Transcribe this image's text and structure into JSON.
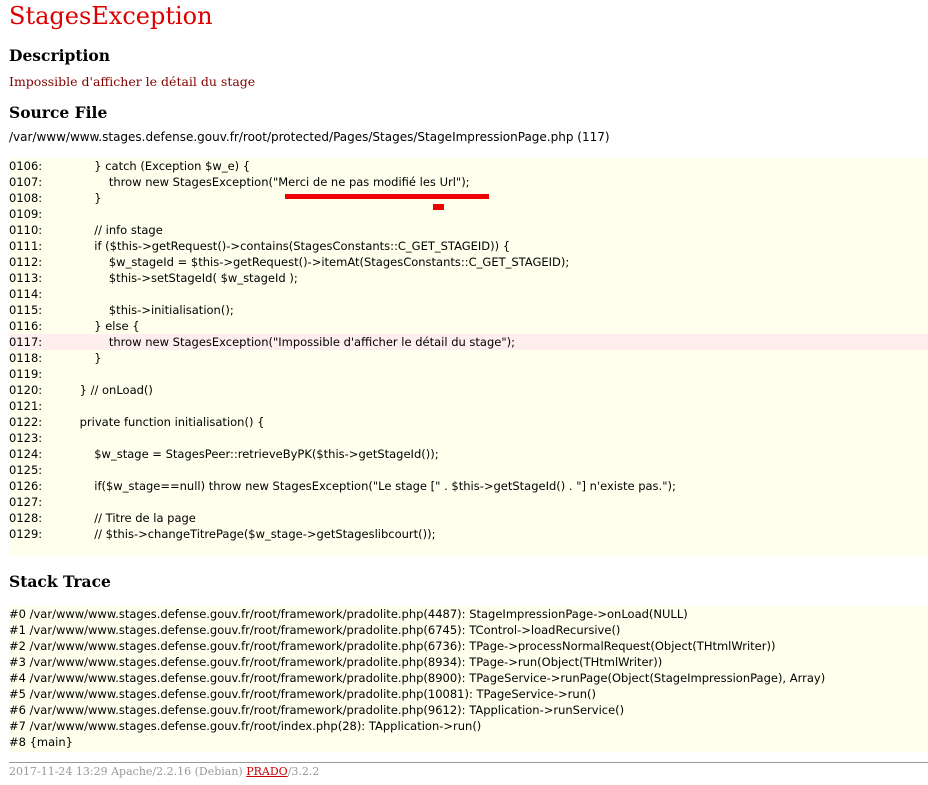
{
  "page": {
    "title": "StagesException",
    "description_heading": "Description",
    "description_text": "Impossible d'afficher le détail du stage",
    "source_heading": "Source File",
    "source_path": "/var/www/www.stages.defense.gouv.fr/root/protected/Pages/Stages/StageImpressionPage.php (117)",
    "stack_heading": "Stack Trace"
  },
  "source_lines": [
    {
      "num": "0106:",
      "code": "        } catch (Exception $w_e) {"
    },
    {
      "num": "0107:",
      "code": "            throw new StagesException(\"Merci de ne pas modifié les Url\");"
    },
    {
      "num": "0108:",
      "code": "        }"
    },
    {
      "num": "0109:",
      "code": ""
    },
    {
      "num": "0110:",
      "code": "        // info stage"
    },
    {
      "num": "0111:",
      "code": "        if ($this->getRequest()->contains(StagesConstants::C_GET_STAGEID)) {"
    },
    {
      "num": "0112:",
      "code": "            $w_stageId = $this->getRequest()->itemAt(StagesConstants::C_GET_STAGEID);"
    },
    {
      "num": "0113:",
      "code": "            $this->setStageId( $w_stageId );"
    },
    {
      "num": "0114:",
      "code": ""
    },
    {
      "num": "0115:",
      "code": "            $this->initialisation();"
    },
    {
      "num": "0116:",
      "code": "        } else {"
    },
    {
      "num": "0117:",
      "code": "            throw new StagesException(\"Impossible d'afficher le détail du stage\");",
      "error": true
    },
    {
      "num": "0118:",
      "code": "        }"
    },
    {
      "num": "0119:",
      "code": ""
    },
    {
      "num": "0120:",
      "code": "    } // onLoad()"
    },
    {
      "num": "0121:",
      "code": ""
    },
    {
      "num": "0122:",
      "code": "    private function initialisation() {"
    },
    {
      "num": "0123:",
      "code": ""
    },
    {
      "num": "0124:",
      "code": "        $w_stage = StagesPeer::retrieveByPK($this->getStageId());"
    },
    {
      "num": "0125:",
      "code": ""
    },
    {
      "num": "0126:",
      "code": "        if($w_stage==null) throw new StagesException(\"Le stage [\" . $this->getStageId() . \"] n'existe pas.\");"
    },
    {
      "num": "0127:",
      "code": ""
    },
    {
      "num": "0128:",
      "code": "        // Titre de la page"
    },
    {
      "num": "0129:",
      "code": "        // $this->changeTitrePage($w_stage->getStageslibcourt());"
    }
  ],
  "stack_trace": [
    "#0 /var/www/www.stages.defense.gouv.fr/root/framework/pradolite.php(4487): StageImpressionPage->onLoad(NULL)",
    "#1 /var/www/www.stages.defense.gouv.fr/root/framework/pradolite.php(6745): TControl->loadRecursive()",
    "#2 /var/www/www.stages.defense.gouv.fr/root/framework/pradolite.php(6736): TPage->processNormalRequest(Object(THtmlWriter))",
    "#3 /var/www/www.stages.defense.gouv.fr/root/framework/pradolite.php(8934): TPage->run(Object(THtmlWriter))",
    "#4 /var/www/www.stages.defense.gouv.fr/root/framework/pradolite.php(8900): TPageService->runPage(Object(StageImpressionPage), Array)",
    "#5 /var/www/www.stages.defense.gouv.fr/root/framework/pradolite.php(10081): TPageService->run()",
    "#6 /var/www/www.stages.defense.gouv.fr/root/framework/pradolite.php(9612): TApplication->runService()",
    "#7 /var/www/www.stages.defense.gouv.fr/root/index.php(28): TApplication->run()",
    "#8 {main}"
  ],
  "footer": {
    "prefix": "2017-11-24 13:29 Apache/2.2.16 (Debian) ",
    "link": "PRADO",
    "suffix": "/3.2.2"
  },
  "colors": {
    "title": "#dd0000",
    "description": "#800000",
    "code_background": "#ffffee",
    "error_line_background": "#ffeeee",
    "markup": "#ee0000",
    "footer_text": "#999999"
  }
}
